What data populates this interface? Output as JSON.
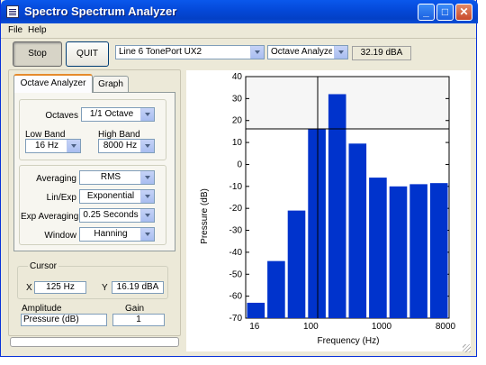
{
  "window": {
    "title": "Spectro Spectrum Analyzer",
    "controls": {
      "minimize": "_",
      "maximize": "□",
      "close": "✕"
    }
  },
  "menu": [
    "File",
    "Help"
  ],
  "toolbar": {
    "stop_label": "Stop",
    "quit_label": "QUIT",
    "device": "Line 6 TonePort UX2",
    "mode": "Octave Analyzer",
    "level_readout": "32.19 dBA"
  },
  "tabs": [
    "Octave Analyzer",
    "Graph"
  ],
  "octave_panel": {
    "octaves_label": "Octaves",
    "octaves_value": "1/1 Octave",
    "low_band_label": "Low Band",
    "low_band_value": "16 Hz",
    "high_band_label": "High Band",
    "high_band_value": "8000 Hz",
    "averaging_label": "Averaging",
    "averaging_value": "RMS",
    "linexp_label": "Lin/Exp",
    "linexp_value": "Exponential",
    "exp_avg_label": "Exp Averaging",
    "exp_avg_value": "0.25 Seconds",
    "window_label": "Window",
    "window_value": "Hanning"
  },
  "cursor": {
    "title": "Cursor",
    "x_label": "X",
    "x_value": "125 Hz",
    "y_label": "Y",
    "y_value": "16.19 dBA"
  },
  "amplitude": {
    "label": "Amplitude",
    "value": "Pressure (dB)"
  },
  "gain": {
    "label": "Gain",
    "value": "1"
  },
  "colors": {
    "bar": "#0033cc",
    "title_bar": "#0a58ec",
    "window_bg": "#ece9d8"
  },
  "chart_data": {
    "type": "bar",
    "xlabel": "Frequency (Hz)",
    "ylabel": "Pressure (dB)",
    "x_scale": "log",
    "ylim": [
      -70,
      40
    ],
    "y_ticks": [
      40,
      30,
      20,
      10,
      0,
      -10,
      -20,
      -30,
      -40,
      -50,
      -60,
      -70
    ],
    "x_ticks": [
      "16",
      "100",
      "1000",
      "8000"
    ],
    "x_tick_values": [
      16,
      100,
      1000,
      8000
    ],
    "categories": [
      "16",
      "31.5",
      "63",
      "125",
      "250",
      "500",
      "1000",
      "2000",
      "4000",
      "8000"
    ],
    "values": [
      -63,
      -44,
      -21,
      16,
      32,
      9.5,
      -6,
      -10,
      -9,
      -8.5
    ],
    "cursor": {
      "x": 125,
      "y": 16.19
    }
  }
}
